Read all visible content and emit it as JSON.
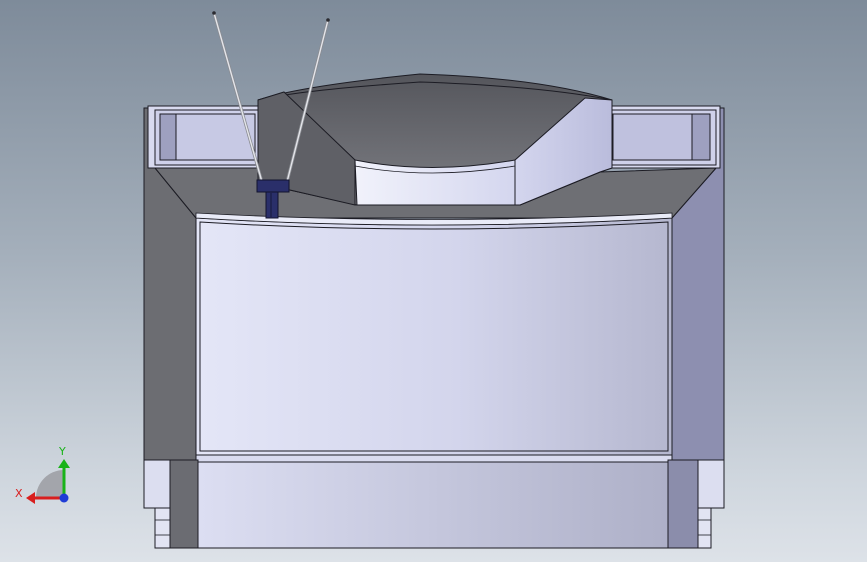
{
  "viewport": {
    "background_top": "#7e8b9a",
    "background_bottom": "#dde2e8"
  },
  "triad": {
    "x_label": "X",
    "y_label": "Y",
    "x_color": "#d81e1e",
    "y_color": "#19b319",
    "z_color": "#1f3cd6"
  },
  "model": {
    "face_light": "#d7d9f0",
    "face_dark": "#6f7076",
    "face_side": "#8d8fb0",
    "edge_color": "#1c1c24",
    "handle_color": "#2a2f6a"
  }
}
